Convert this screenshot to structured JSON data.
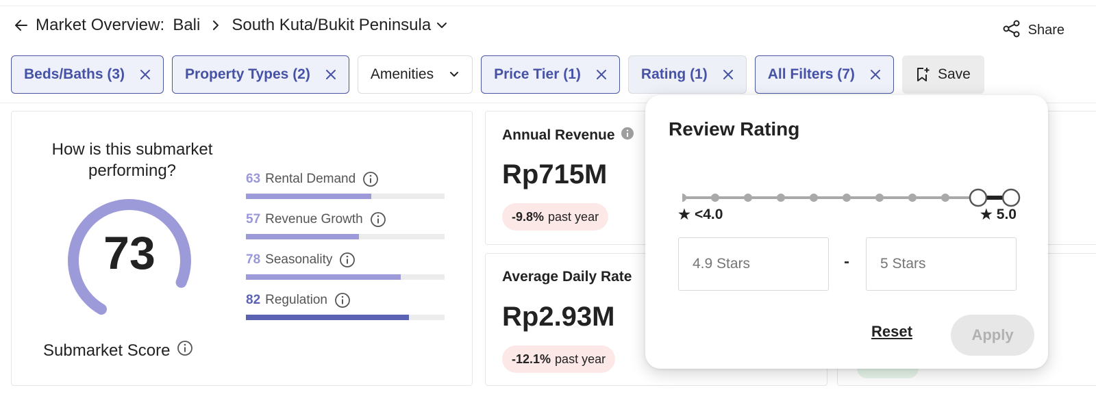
{
  "header": {
    "title": "Market Overview:",
    "location": "Bali",
    "submarket": "South Kuta/Bukit Peninsula",
    "share_label": "Share"
  },
  "filters": [
    {
      "label": "Beds/Baths (3)",
      "active": true
    },
    {
      "label": "Property Types (2)",
      "active": true
    },
    {
      "label": "Amenities",
      "active": false
    },
    {
      "label": "Price Tier (1)",
      "active": true
    },
    {
      "label": "Rating (1)",
      "active": true
    },
    {
      "label": "All Filters (7)",
      "active": true
    }
  ],
  "save_label": "Save",
  "score": {
    "question": "How is this submarket performing?",
    "value": "73",
    "label": "Submarket Score",
    "gauge_fraction": 0.73,
    "metrics": [
      {
        "value": "63",
        "label": "Rental Demand",
        "fraction": 0.63
      },
      {
        "value": "57",
        "label": "Revenue Growth",
        "fraction": 0.57
      },
      {
        "value": "78",
        "label": "Seasonality",
        "fraction": 0.78
      },
      {
        "value": "82",
        "label": "Regulation",
        "fraction": 0.82
      }
    ]
  },
  "revenue": {
    "title": "Annual Revenue",
    "value": "Rp715M",
    "change": "-9.8%",
    "change_suffix": "past year"
  },
  "adr": {
    "title": "Average Daily Rate",
    "value": "Rp2.93M",
    "change": "-12.1%",
    "change_suffix": "past year"
  },
  "rating_popover": {
    "title": "Review Rating",
    "min_label": "<4.0",
    "max_label": "5.0",
    "min_placeholder": "4.9 Stars",
    "max_placeholder": "5 Stars",
    "separator": "-",
    "reset_label": "Reset",
    "apply_label": "Apply",
    "selected_range": [
      4.9,
      5.0
    ]
  },
  "colors": {
    "accent": "#4552a6",
    "gauge": "#9d9ad9",
    "dark_bar": "#5c62b2",
    "negative_badge": "#fde8e8"
  }
}
